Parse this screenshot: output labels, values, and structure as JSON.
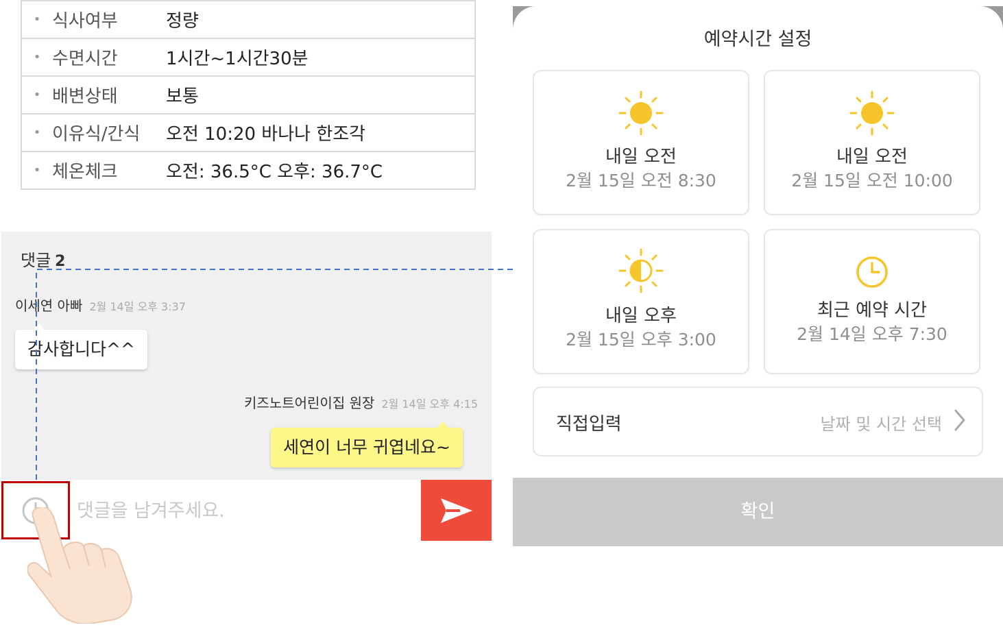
{
  "info_rows": [
    {
      "label": "식사여부",
      "value": "정량"
    },
    {
      "label": "수면시간",
      "value": "1시간~1시간30분"
    },
    {
      "label": "배변상태",
      "value": "보통"
    },
    {
      "label": "이유식/간식",
      "value": "오전 10:20 바나나 한조각"
    },
    {
      "label": "체온체크",
      "value": "오전: 36.5°C 오후: 36.7°C"
    }
  ],
  "comments": {
    "title": "댓글",
    "count": "2",
    "items": [
      {
        "author": "이세연 아빠",
        "time": "2월 14일 오후 3:37",
        "text": "감사합니다^^"
      },
      {
        "author": "키즈노트어린이집 원장",
        "time": "2월 14일 오후 4:15",
        "text": "세연이 너무 귀엽네요~"
      }
    ],
    "input_placeholder": "댓글을 남겨주세요."
  },
  "reservation": {
    "title": "예약시간 설정",
    "options": [
      {
        "title": "내일 오전",
        "sub": "2월 15일 오전 8:30",
        "icon": "sun-icon"
      },
      {
        "title": "내일 오전",
        "sub": "2월 15일 오전 10:00",
        "icon": "sun-icon"
      },
      {
        "title": "내일 오후",
        "sub": "2월 15일 오후 3:00",
        "icon": "half-sun-icon"
      },
      {
        "title": "최근 예약 시간",
        "sub": "2월 14일 오후 7:30",
        "icon": "clock-icon"
      }
    ],
    "direct_label": "직접입력",
    "direct_hint": "날짜 및 시간 선택",
    "confirm_label": "확인"
  },
  "colors": {
    "send_button": "#f04a3a",
    "highlight_box": "#c00000",
    "icon_yellow": "#f5c52b",
    "arrow_blue": "#4472c4",
    "yellow_bubble": "#fdf78a",
    "confirm_bar": "#c9c9c9"
  }
}
